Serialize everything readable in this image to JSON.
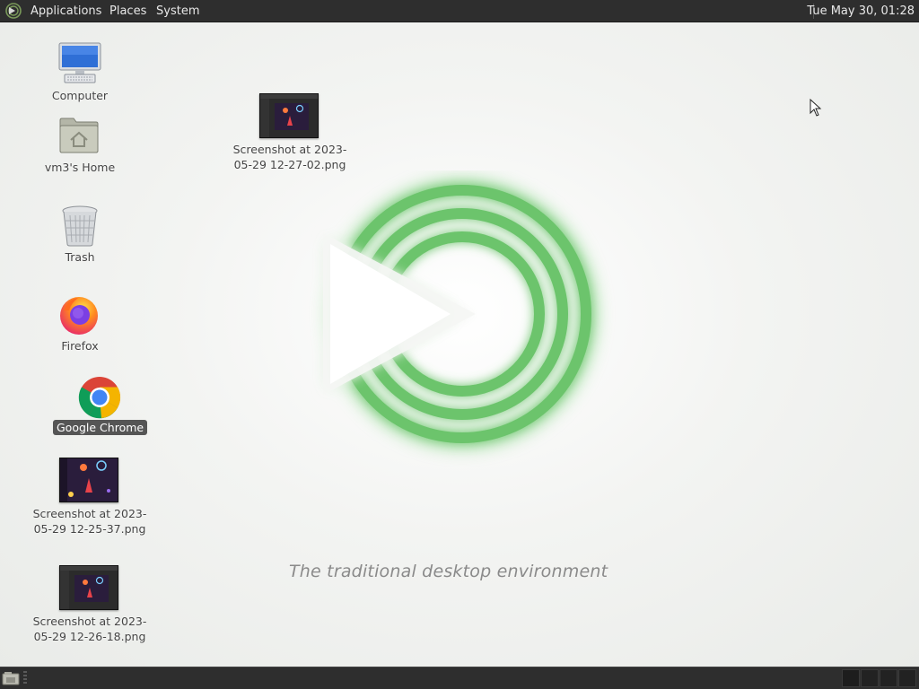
{
  "top_panel": {
    "menus": [
      "Applications",
      "Places",
      "System"
    ],
    "clock": "Tue May 30, 01:28",
    "logo_icon": "mate-logo-icon"
  },
  "desktop": {
    "icons": [
      {
        "label": "Computer",
        "icon": "computer-icon"
      },
      {
        "label": "vm3's Home",
        "icon": "home-folder-icon"
      },
      {
        "label": "Trash",
        "icon": "trash-icon"
      },
      {
        "label": "Firefox",
        "icon": "firefox-icon"
      },
      {
        "label": "Google Chrome",
        "icon": "chrome-icon",
        "selected": true
      },
      {
        "label": "Screenshot at 2023-05-29 12-25-37.png",
        "icon": "image-file-icon"
      },
      {
        "label": "Screenshot at 2023-05-29 12-26-18.png",
        "icon": "image-file-icon"
      },
      {
        "label": "Screenshot at 2023-05-29 12-27-02.png",
        "icon": "image-file-icon"
      }
    ]
  },
  "wallpaper": {
    "tagline": "The traditional desktop environment",
    "accent_color": "#6cc46c"
  },
  "bottom_panel": {
    "show_desktop_icon": "show-desktop-icon",
    "workspaces": 4
  },
  "colors": {
    "panel_bg": "#2e2e2e",
    "desktop_bg": "#f1f2f0",
    "selection_bg": "#555555"
  }
}
